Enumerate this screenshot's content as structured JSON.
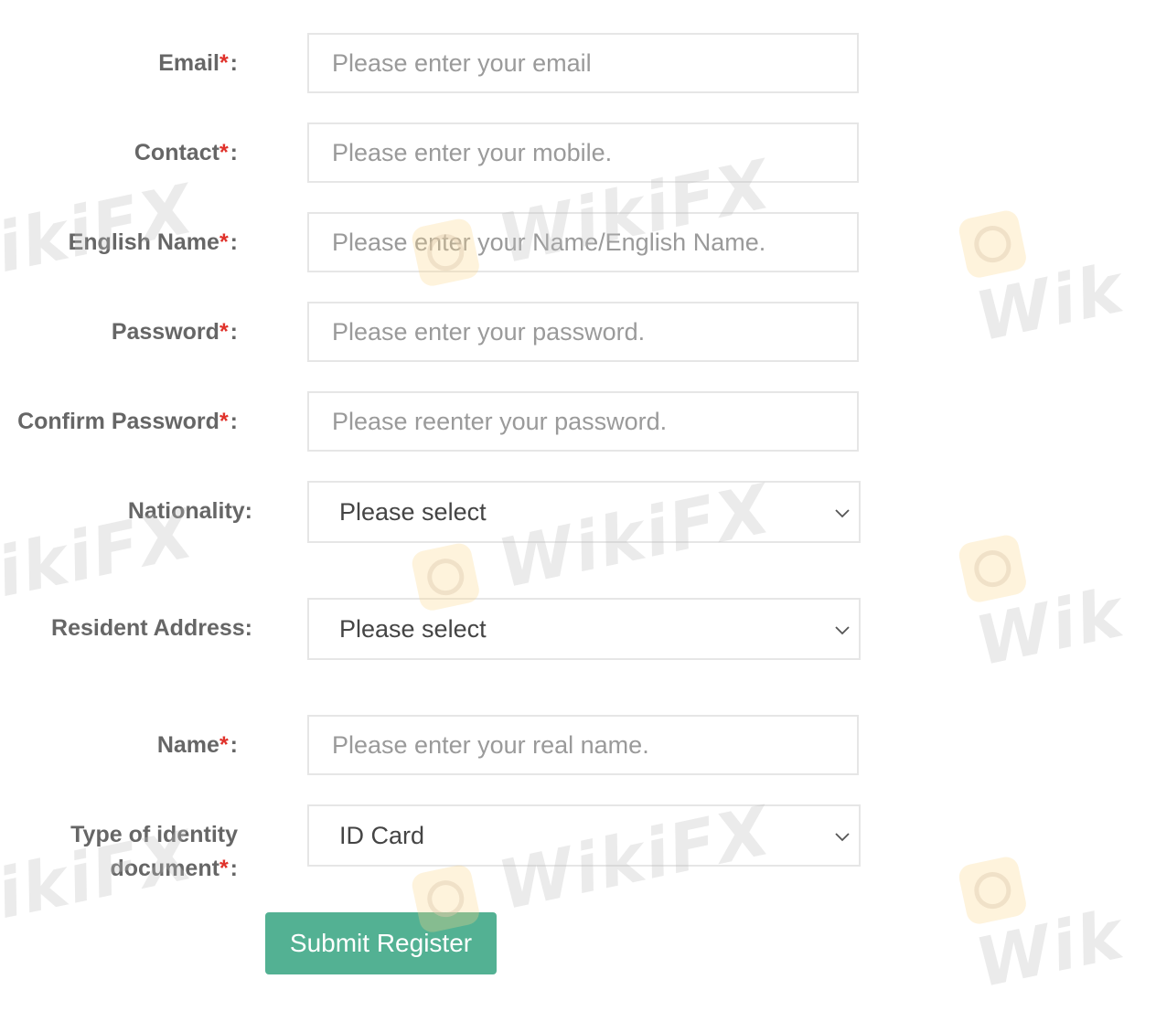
{
  "form": {
    "required_mark": "*",
    "colon": ":",
    "email": {
      "label": "Email",
      "placeholder": "Please enter your email"
    },
    "contact": {
      "label": "Contact",
      "placeholder": "Please enter your mobile."
    },
    "english_name": {
      "label": "English Name",
      "placeholder": "Please enter your Name/English Name."
    },
    "password": {
      "label": "Password",
      "placeholder": "Please enter your password."
    },
    "confirm_password": {
      "label": "Confirm Password",
      "placeholder": "Please reenter your password."
    },
    "nationality": {
      "label": "Nationality:",
      "selected": "Please select"
    },
    "resident_address": {
      "label": "Resident Address:",
      "selected": "Please select"
    },
    "name": {
      "label": "Name",
      "placeholder": "Please enter your real name."
    },
    "identity_type": {
      "label": "Type of identity document",
      "selected": "ID Card"
    },
    "submit_label": "Submit Register"
  },
  "watermark": {
    "text": "WikiFX",
    "partial_text": "ikiFX",
    "edge_text": "Wik"
  },
  "icons": {
    "chevron": "chevron-down-icon",
    "watermark_logo": "wikifx-logo-icon"
  },
  "colors": {
    "accent": "#53b193",
    "required": "#e0322b",
    "label": "#666666",
    "border": "#e6e6e6",
    "placeholder": "#9a9a9a"
  }
}
